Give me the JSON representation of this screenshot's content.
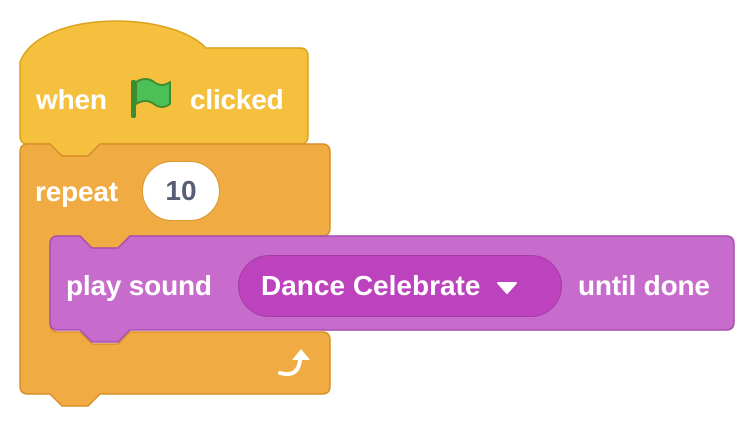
{
  "hat_block": {
    "prefix": "when",
    "suffix": "clicked",
    "icon": "green-flag-icon",
    "color": "#ffbf00"
  },
  "repeat_block": {
    "label": "repeat",
    "count": "10",
    "icon": "loop-arrow-icon",
    "color": "#ffab19"
  },
  "sound_block": {
    "prefix": "play sound",
    "sound": "Dance Celebrate",
    "suffix": "until done",
    "dropdown_icon": "caret-down-icon",
    "color": "#cf63cf"
  }
}
